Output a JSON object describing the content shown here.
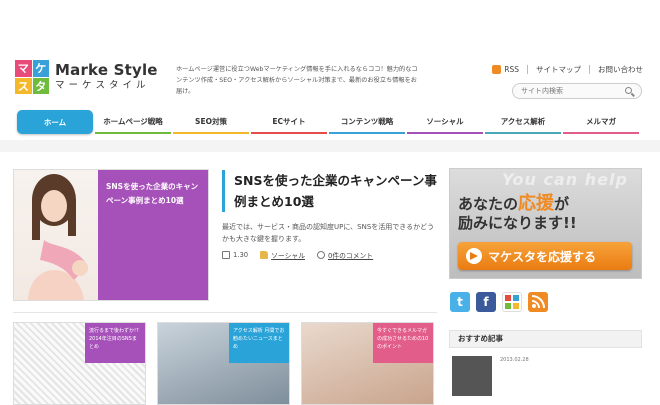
{
  "logo": {
    "mark_chars": [
      "マ",
      "ケ",
      "ス",
      "タ"
    ],
    "name_en": "Marke Style",
    "name_ja": "マーケスタイル"
  },
  "tagline": "ホームページ運営に役立つWebマーケティング情報を手に入れるならココ！魅力的なコンテンツ作成・SEO・アクセス解析からソーシャル対策まで、最新のお役立ち情報をお届け。",
  "header_links": {
    "rss": "RSS",
    "sitemap": "サイトマップ",
    "contact": "お問い合わせ"
  },
  "search": {
    "placeholder": "サイト内検索"
  },
  "nav": {
    "items": [
      {
        "label": "ホーム",
        "color": "#2aa3d9"
      },
      {
        "label": "ホームページ戦略",
        "color": "#6fbb3c"
      },
      {
        "label": "SEO対策",
        "color": "#f3b92b"
      },
      {
        "label": "ECサイト",
        "color": "#e84b4b"
      },
      {
        "label": "コンテンツ戦略",
        "color": "#3aa0d8"
      },
      {
        "label": "ソーシャル",
        "color": "#a650b9"
      },
      {
        "label": "アクセス解析",
        "color": "#4aa8b8"
      },
      {
        "label": "メルマガ",
        "color": "#e35d8a"
      }
    ]
  },
  "feature": {
    "image_caption": "SNSを使った企業のキャンペーン事例まとめ10選",
    "title": "SNSを使った企業のキャンペーン事例まとめ10選",
    "description": "最近では、サービス・商品の認知度UPに、SNSを活用できるかどうかも大きな鍵を握ります。",
    "date": "1.30",
    "category": "ソーシャル",
    "comments": "0件のコメント"
  },
  "cards": [
    {
      "caption": "流行るまで後わずか!? 2014年注目のSNSまとめ"
    },
    {
      "caption": "アクセス解析 月間でお勧めたいニュースまとめ"
    },
    {
      "caption": "今すぐできるメルマガの成功させるための10のポイント"
    }
  ],
  "sidebar": {
    "banner_watermark": "You can help",
    "banner_line1_a": "あなたの",
    "banner_line1_hl": "応援",
    "banner_line1_b": "が",
    "banner_line2": "励みになります!!",
    "banner_button": "マケスタを応援する",
    "social": {
      "twitter": "t",
      "facebook": "f",
      "googleplus": "g"
    },
    "recommended_heading": "おすすめ記事",
    "recommended_date": "2013.02.28"
  }
}
